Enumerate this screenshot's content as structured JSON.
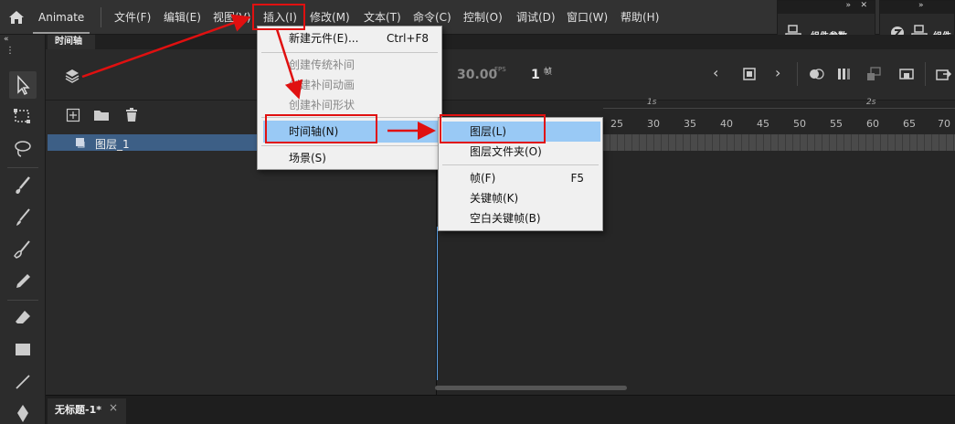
{
  "app": {
    "name": "Animate"
  },
  "menubar": {
    "items": [
      "文件(F)",
      "编辑(E)",
      "视图(V)",
      "插入(I)",
      "修改(M)",
      "文本(T)",
      "命令(C)",
      "控制(O)",
      "调试(D)",
      "窗口(W)",
      "帮助(H)"
    ]
  },
  "right_panels": {
    "component_params": "组件参数",
    "second_label": "组件"
  },
  "timeline": {
    "tab_label": "时间轴",
    "fps": "30.00",
    "fps_unit": "FPS",
    "frame": "1",
    "frame_unit": "帧",
    "layer_name": "图层_1",
    "ruler_seconds": [
      "1s",
      "2s"
    ],
    "ruler_numbers": [
      "25",
      "30",
      "35",
      "40",
      "45",
      "50",
      "55",
      "60",
      "65",
      "70"
    ]
  },
  "insert_menu": {
    "items": [
      {
        "label": "新建元件(E)...",
        "shortcut": "Ctrl+F8"
      },
      {
        "label": "创建传统补间"
      },
      {
        "label": "创建补间动画"
      },
      {
        "label": "创建补间形状"
      },
      {
        "label": "时间轴(N)"
      },
      {
        "label": "场景(S)"
      }
    ]
  },
  "timeline_submenu": {
    "items": [
      {
        "label": "图层(L)"
      },
      {
        "label": "图层文件夹(O)"
      },
      {
        "label": "帧(F)",
        "shortcut": "F5"
      },
      {
        "label": "关键帧(K)"
      },
      {
        "label": "空白关键帧(B)"
      }
    ]
  },
  "document": {
    "tab_label": "无标题-1*",
    "close": "×"
  },
  "colors": {
    "highlight": "#99c9f5",
    "annotation": "#e01010",
    "layer_row": "#3d5f86"
  }
}
